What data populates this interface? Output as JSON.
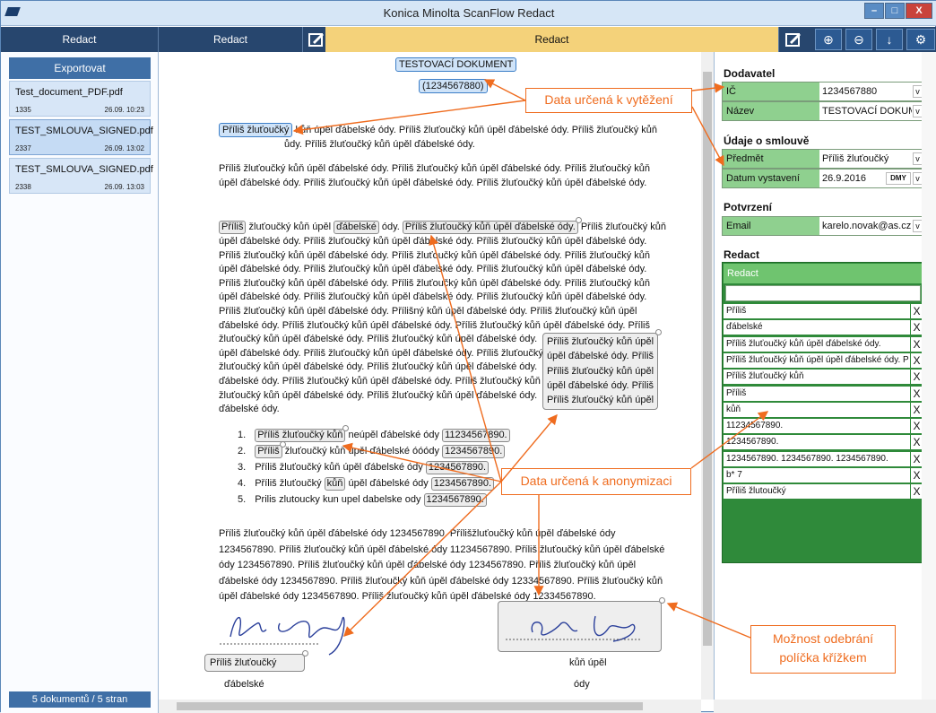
{
  "window": {
    "title": "Konica Minolta ScanFlow Redact",
    "min": "–",
    "max": "□",
    "close": "X"
  },
  "toolbar": {
    "tabs": [
      "Redact",
      "Redact",
      "Redact"
    ],
    "icons": [
      "zoom-in-icon",
      "zoom-out-icon",
      "download-icon",
      "settings-icon"
    ]
  },
  "sidebar": {
    "export": "Exportovat",
    "docs": [
      {
        "name": "Test_document_PDF.pdf",
        "pages": "1335",
        "date": "26.09.  10:23"
      },
      {
        "name": "TEST_SMLOUVA_SIGNED.pdf",
        "pages": "2337",
        "date": "26.09.  13:02"
      },
      {
        "name": "TEST_SMLOUVA_SIGNED.pdf",
        "pages": "2338",
        "date": "26.09.  13:03"
      }
    ],
    "status": "5 dokumentů / 5 stran"
  },
  "doc": {
    "heading": "TESTOVACÍ DOKUMENT",
    "heading_num": "(1234567880)",
    "l1a": "Příliš žluťoučký",
    "l1b": " kůň úpěl ďábelské ódy. Příliš žluťoučký kůň úpěl ďábelské ódy. Příliš žluťoučký kůň",
    "l2": "ůdy. Příliš žluťoučký kůň úpěl ďábelské ódy.",
    "p2a": "Příliš žluťoučký kůň úpěl ďábelské ódy. Příliš žluťoučký kůň úpěl ďábelské ódy. Příliš žluťoučký kůň",
    "p2b": "úpěl ďábelské ódy. Příliš žluťoučký kůň úpěl ďábelské ódy. Příliš žluťoučký kůň úpěl ďábelské ódy.",
    "p3_w1": "Příliš",
    "p3_t1": " žluťoučký kůň úpěl ",
    "p3_w2": "ďábelské",
    "p3_t2": " ódy. ",
    "p3_w3": "Příliš žluťoučký kůň úpěl ďábelské ódy.",
    "p3_t3": " Příliš žluťoučký kůň",
    "p3_lines": [
      "úpěl ďábelské ódy. Příliš žluťoučký kůň úpěl ďábelské ódy. Příliš žluťoučký kůň úpěl ďábelské ódy.",
      "Příliš žluťoučký kůň úpěl ďábelské ódy. Příliš žluťoučký kůň úpěl ďábelské ódy. Příliš žluťoučký kůň",
      "úpěl ďábelské ódy. Příliš žluťoučký kůň úpěl ďábelské ódy. Příliš žluťoučký kůň úpěl ďábelské ódy.",
      "Příliš žluťoučký kůň úpěl ďábelské ódy. Příliš žluťoučký kůň úpěl ďábelské ódy. Příliš žluťoučký kůň",
      "úpěl ďábelské ódy. Příliš žluťoučký kůň úpěl ďábelské ódy. Příliš žluťoučký kůň úpěl ďábelské ódy.",
      "Příliš žluťoučký kůň úpěl ďábelské ódy. Přílišný kůň úpěl ďábelské ódy. Příliš žluťoučký kůň úpěl",
      "ďábelské ódy. Příliš žluťoučký kůň úpěl ďábelské ódy. Příliš žluťoučký kůň úpěl ďábelské ódy. Příliš",
      "žluťoučký kůň úpěl ďábelské ódy. Příliš žluťoučký kůň úpěl ďábelské ódy.",
      "úpěl ďábelské ódy. Příliš žluťoučký kůň úpěl ďábelské ódy. Příliš žluťoučký kůň",
      "žluťoučký kůň úpěl ďábelské ódy. Příliš žluťoučký kůň úpěl ďábelské ódy.",
      "ďábelské ódy. Příliš žluťoučký kůň úpěl ďábelské ódy. Příliš žluťoučký kůň",
      "žluťoučký kůň úpěl ďábelské ódy. Příliš žluťoučký kůň úpěl ďábelské ódy.",
      "ďábelské ódy."
    ],
    "box_lines": [
      "Příliš žluťoučký kůň úpěl",
      "úpěl ďábelské ódy. Příliš",
      "Příliš žluťoučký kůň úpěl",
      "úpěl ďábelské ódy. Příliš",
      "Příliš žluťoučký kůň úpěl"
    ],
    "list": [
      {
        "n": "1.",
        "a": "Příliš žluťoučký kůň",
        "b": " neúpěl ďábelské ódy ",
        "c": "11234567890."
      },
      {
        "n": "2.",
        "a": "Příliš",
        "b": " žluťoučký kůň úpěl ďábelské óóódy ",
        "c": "1234567890."
      },
      {
        "n": "3.",
        "a": "",
        "b": "Příliš žluťoučký kůň úpěl ďábelské ódy ",
        "c": "1234567890."
      },
      {
        "n": "4.",
        "a": "",
        "b": "Příliš žluťoučký ",
        "c": "kůň",
        "d": " úpěl ďábelské ódy ",
        "e": "1234567890."
      },
      {
        "n": "5.",
        "a": "",
        "b": "Prilis zlutoucky kun upel dabelske ody ",
        "c": "1234567890."
      }
    ],
    "p4": [
      "Příliš žluťoučký kůň úpěl ďábelské ódy 1234567890. Přílišžluťoučký kůň úpěl ďábelské  ódy",
      "1234567890. Příliš žluťoučký kůň úpěl ďábelské ódy 11234567890. Příliš žluťoučký kůň úpěl ďábelské",
      "ódy 1234567890. Příliš žluťoučký kůň úpěl ďábelské ódy 1234567890. Příliš žluťoučký kůň úpěl",
      "ďábelské ódy 1234567890. Příliš žluťoučký kůň úpěl ďábelské ódy 12334567890. Příliš žluťoučký kůň",
      "úpěl ďábelské ódy 1234567890. Příliš žluťoučký kůň úpěl ďábelské ódy 12334567890."
    ],
    "sig_box": "Příliš žluťoučký",
    "sig_under": "ďábelské",
    "sig2_a": "kůň úpěl",
    "sig2_b": "ódy"
  },
  "panel": {
    "dodavatel": "Dodavatel",
    "ic_label": "IČ",
    "ic_val": "1234567880",
    "nazev_label": "Název",
    "nazev_val": "TESTOVACÍ DOKUMEI",
    "smlouva": "Údaje o smlouvě",
    "predmet_label": "Předmět",
    "predmet_val": "Příliš žluťoučký",
    "datum_label": "Datum vystavení",
    "datum_val": "26.9.2016",
    "dmy": "DMY",
    "potvrzeni": "Potvrzení",
    "email_label": "Email",
    "email_val": "karelo.novak@as.cz",
    "redact": "Redact",
    "redact_col": "Redact",
    "rows": [
      "Příliš",
      "ďábelské",
      "Příliš žluťoučký kůň úpěl ďábelské ódy.",
      "Příliš žluťoučký kůň úpěl úpěl ďábelské ódy. P",
      "Příliš žluťoučký kůň",
      "Příliš",
      "kůň",
      "11234567890.",
      "1234567890.",
      "1234567890. 1234567890. 1234567890.",
      "b* 7",
      "Příliš žlutoučký"
    ],
    "dd": "v",
    "x": "X"
  },
  "callouts": {
    "extract": "Data určená k vytěžení",
    "anon": "Data určená k anonymizaci",
    "remove": "Možnost odebrání políčka křížkem"
  },
  "colors": {
    "accent": "#ef6c1f",
    "toolbar": "#27466e",
    "green": "#8fd08f"
  }
}
